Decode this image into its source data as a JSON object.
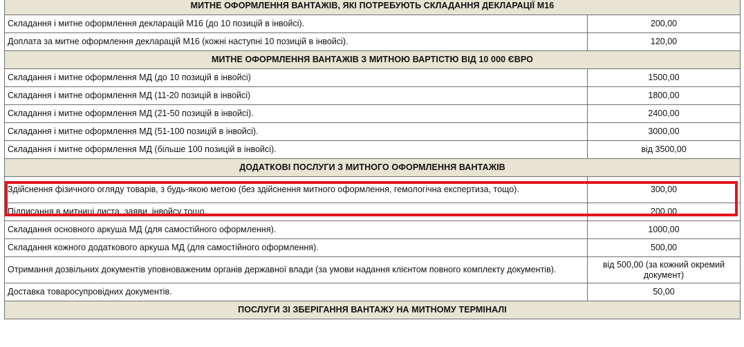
{
  "sections": [
    {
      "title": "МИТНЕ ОФОРМЛЕННЯ ВАНТАЖІВ, ЯКІ ПОТРЕБУЮТЬ СКЛАДАННЯ ДЕКЛАРАЦІЇ М16",
      "rows": [
        {
          "desc": "Складання  і  митне оформлення  декларацій  М16  (до 10 позицій в інвойсі).",
          "price": "200,00"
        },
        {
          "desc": "Доплата за митне оформлення декларацій М16 (кожні наступні  10 позицій в інвойсі).",
          "price": "120,00"
        }
      ]
    },
    {
      "title": "МИТНЕ ОФОРМЛЕННЯ ВАНТАЖІВ З МИТНОЮ ВАРТІСТЮ ВІД 10 000 ЄВРО",
      "rows": [
        {
          "desc": "Складання  і  митне оформлення  МД (до 10 позицій в інвойсі)",
          "price": "1500,00"
        },
        {
          "desc": "Складання і митне оформлення  МД (11-20 позицій в інвойсі)",
          "price": "1800,00"
        },
        {
          "desc": "Складання і митне оформлення  МД (21-50 позицій в інвойсі).",
          "price": "2400,00"
        },
        {
          "desc": "Складання і митне оформлення  МД (51-100 позицій в інвойсі).",
          "price": "3000,00"
        },
        {
          "desc": "Складання і митне оформлення  МД (більше 100 позицій в інвойсі).",
          "price": "від 3500,00"
        }
      ]
    },
    {
      "title": "ДОДАТКОВІ ПОСЛУГИ З МИТНОГО ОФОРМЛЕННЯ ВАНТАЖІВ",
      "rows": [
        {
          "desc": "Здійснення фізичного огляду товарів, з будь-якою метою (без здійснення митного оформлення, гемологічна експертиза, тощо).",
          "price": "300,00"
        },
        {
          "desc": "Підписання в митниці листа, заяви, інвойсу тощо.",
          "price": "200,00"
        },
        {
          "desc": "Складання основного аркуша МД (для самостійного оформлення).",
          "price": "1000,00"
        },
        {
          "desc": "Складання кожного додаткового аркуша МД (для самостійного оформлення).",
          "price": "500,00"
        },
        {
          "desc": "Отримання дозвільних документів уповноваженим органів державної влади (за умови надання клієнтом повного комплекту документів).",
          "price": "від 500,00 (за кожний окремий документ)"
        },
        {
          "desc": "Доставка товаросупровідних документів.",
          "price": "50,00"
        }
      ]
    },
    {
      "title": "ПОСЛУГИ ЗІ ЗБЕРІГАННЯ ВАНТАЖУ НА МИТНОМУ ТЕРМІНАЛІ",
      "rows": []
    }
  ],
  "highlight_color": "#e3141a",
  "section_bg": "#e8e4d3"
}
